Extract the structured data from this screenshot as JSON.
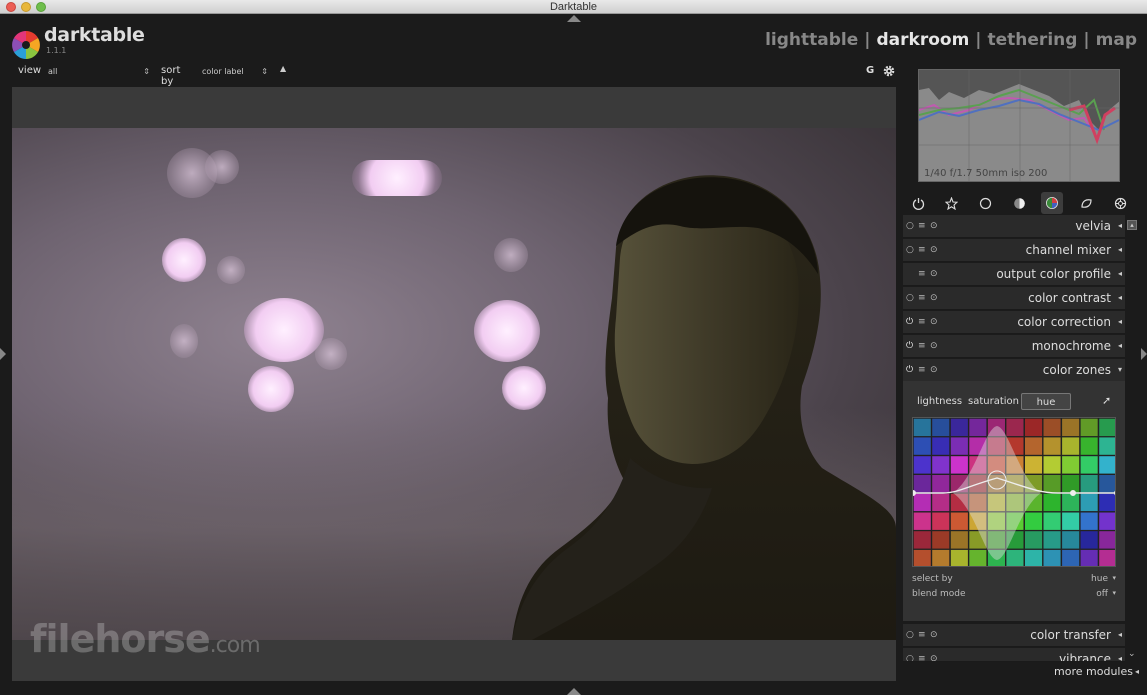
{
  "window": {
    "title": "Darktable"
  },
  "app": {
    "name": "darktable",
    "version": "1.1.1"
  },
  "views": {
    "items": [
      "lighttable",
      "darkroom",
      "tethering",
      "map"
    ],
    "active": "darkroom",
    "separator": "|"
  },
  "filter": {
    "view_label": "view",
    "view_value": "all",
    "sort_label": "sort by",
    "sort_value": "color label",
    "sort_dir": "▲",
    "grouping_label": "G"
  },
  "histogram": {
    "info": "1/40 f/1.7 50mm iso 200"
  },
  "module_groups": [
    "power-icon",
    "favorites-icon",
    "basic-circle-icon",
    "tone-icon",
    "color-icon",
    "correct-icon",
    "effect-icon"
  ],
  "modules": [
    {
      "name": "velvia",
      "arrow": "◂"
    },
    {
      "name": "channel mixer",
      "arrow": "◂"
    },
    {
      "name": "output color profile",
      "arrow": "◂"
    },
    {
      "name": "color contrast",
      "arrow": "◂"
    },
    {
      "name": "color correction",
      "arrow": "◂"
    },
    {
      "name": "monochrome",
      "arrow": "◂"
    },
    {
      "name": "color zones",
      "arrow": "▾"
    }
  ],
  "color_zones": {
    "tabs": [
      "lightness",
      "saturation",
      "hue"
    ],
    "active_tab": "hue",
    "select_by_label": "select by",
    "select_by_value": "hue",
    "blend_mode_label": "blend mode",
    "blend_mode_value": "off",
    "chev": "▾"
  },
  "bottom_modules": [
    {
      "name": "color transfer",
      "arrow": "◂"
    },
    {
      "name": "vibrance",
      "arrow": "◂"
    }
  ],
  "more_modules": "more modules",
  "watermark": {
    "main": "filehorse",
    "suffix": ".com"
  },
  "colors": {
    "accent": "#e6e6e6",
    "panel": "#2a2a2a",
    "bg": "#1b1b1b"
  }
}
